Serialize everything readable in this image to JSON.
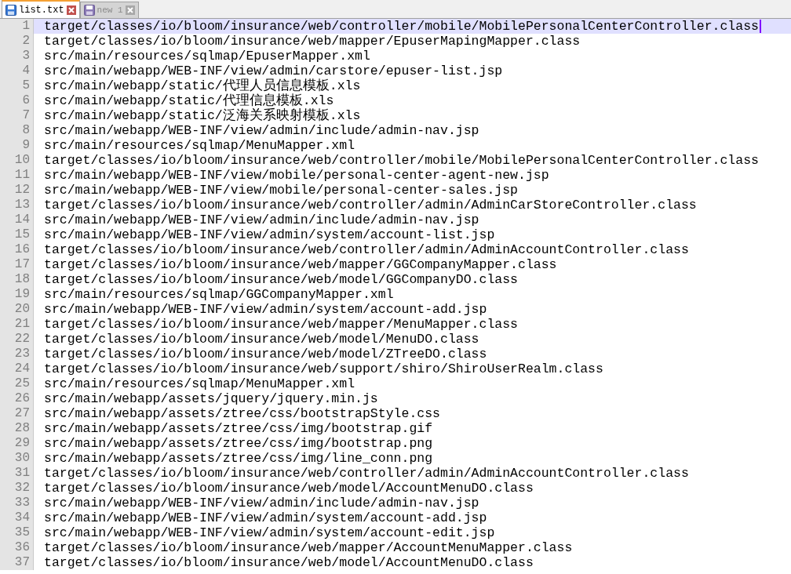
{
  "tabs": [
    {
      "label": "list.txt",
      "selected": true
    },
    {
      "label": "new 1",
      "selected": false
    }
  ],
  "lines": [
    {
      "number": "1",
      "text": "target/classes/io/bloom/insurance/web/controller/mobile/MobilePersonalCenterController.class",
      "current": true
    },
    {
      "number": "2",
      "text": "target/classes/io/bloom/insurance/web/mapper/EpuserMapingMapper.class",
      "current": false
    },
    {
      "number": "3",
      "text": "src/main/resources/sqlmap/EpuserMapper.xml",
      "current": false
    },
    {
      "number": "4",
      "text": "src/main/webapp/WEB-INF/view/admin/carstore/epuser-list.jsp",
      "current": false
    },
    {
      "number": "5",
      "text": "src/main/webapp/static/代理人员信息模板.xls",
      "current": false
    },
    {
      "number": "6",
      "text": "src/main/webapp/static/代理信息模板.xls",
      "current": false
    },
    {
      "number": "7",
      "text": "src/main/webapp/static/泛海关系映射模板.xls",
      "current": false
    },
    {
      "number": "8",
      "text": "src/main/webapp/WEB-INF/view/admin/include/admin-nav.jsp",
      "current": false
    },
    {
      "number": "9",
      "text": "src/main/resources/sqlmap/MenuMapper.xml",
      "current": false
    },
    {
      "number": "10",
      "text": "target/classes/io/bloom/insurance/web/controller/mobile/MobilePersonalCenterController.class",
      "current": false
    },
    {
      "number": "11",
      "text": "src/main/webapp/WEB-INF/view/mobile/personal-center-agent-new.jsp",
      "current": false
    },
    {
      "number": "12",
      "text": "src/main/webapp/WEB-INF/view/mobile/personal-center-sales.jsp",
      "current": false
    },
    {
      "number": "13",
      "text": "target/classes/io/bloom/insurance/web/controller/admin/AdminCarStoreController.class",
      "current": false
    },
    {
      "number": "14",
      "text": "src/main/webapp/WEB-INF/view/admin/include/admin-nav.jsp",
      "current": false
    },
    {
      "number": "15",
      "text": "src/main/webapp/WEB-INF/view/admin/system/account-list.jsp",
      "current": false
    },
    {
      "number": "16",
      "text": "target/classes/io/bloom/insurance/web/controller/admin/AdminAccountController.class",
      "current": false
    },
    {
      "number": "17",
      "text": "target/classes/io/bloom/insurance/web/mapper/GGCompanyMapper.class",
      "current": false
    },
    {
      "number": "18",
      "text": "target/classes/io/bloom/insurance/web/model/GGCompanyDO.class",
      "current": false
    },
    {
      "number": "19",
      "text": "src/main/resources/sqlmap/GGCompanyMapper.xml",
      "current": false
    },
    {
      "number": "20",
      "text": "src/main/webapp/WEB-INF/view/admin/system/account-add.jsp",
      "current": false
    },
    {
      "number": "21",
      "text": "target/classes/io/bloom/insurance/web/mapper/MenuMapper.class",
      "current": false
    },
    {
      "number": "22",
      "text": "target/classes/io/bloom/insurance/web/model/MenuDO.class",
      "current": false
    },
    {
      "number": "23",
      "text": "target/classes/io/bloom/insurance/web/model/ZTreeDO.class",
      "current": false
    },
    {
      "number": "24",
      "text": "target/classes/io/bloom/insurance/web/support/shiro/ShiroUserRealm.class",
      "current": false
    },
    {
      "number": "25",
      "text": "src/main/resources/sqlmap/MenuMapper.xml",
      "current": false
    },
    {
      "number": "26",
      "text": "src/main/webapp/assets/jquery/jquery.min.js",
      "current": false
    },
    {
      "number": "27",
      "text": "src/main/webapp/assets/ztree/css/bootstrapStyle.css",
      "current": false
    },
    {
      "number": "28",
      "text": "src/main/webapp/assets/ztree/css/img/bootstrap.gif",
      "current": false
    },
    {
      "number": "29",
      "text": "src/main/webapp/assets/ztree/css/img/bootstrap.png",
      "current": false
    },
    {
      "number": "30",
      "text": "src/main/webapp/assets/ztree/css/img/line_conn.png",
      "current": false
    },
    {
      "number": "31",
      "text": "target/classes/io/bloom/insurance/web/controller/admin/AdminAccountController.class",
      "current": false
    },
    {
      "number": "32",
      "text": "target/classes/io/bloom/insurance/web/model/AccountMenuDO.class",
      "current": false
    },
    {
      "number": "33",
      "text": "src/main/webapp/WEB-INF/view/admin/include/admin-nav.jsp",
      "current": false
    },
    {
      "number": "34",
      "text": "src/main/webapp/WEB-INF/view/admin/system/account-add.jsp",
      "current": false
    },
    {
      "number": "35",
      "text": "src/main/webapp/WEB-INF/view/admin/system/account-edit.jsp",
      "current": false
    },
    {
      "number": "36",
      "text": "target/classes/io/bloom/insurance/web/mapper/AccountMenuMapper.class",
      "current": false
    },
    {
      "number": "37",
      "text": "target/classes/io/bloom/insurance/web/model/AccountMenuDO.class",
      "current": false
    }
  ]
}
